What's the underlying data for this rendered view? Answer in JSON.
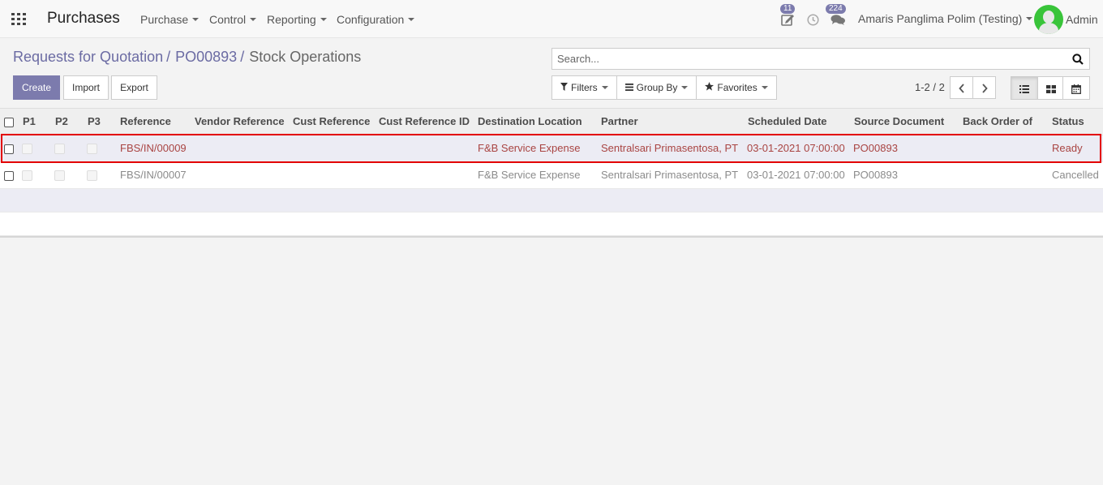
{
  "navbar": {
    "app_title": "Purchases",
    "menus": [
      "Purchase",
      "Control",
      "Reporting",
      "Configuration"
    ],
    "activity_badge": "11",
    "messages_badge": "224",
    "company": "Amaris Panglima Polim (Testing)",
    "user": "Admin"
  },
  "breadcrumb": {
    "items": [
      "Requests for Quotation",
      "PO00893"
    ],
    "separator": "/",
    "current": "Stock Operations"
  },
  "search": {
    "placeholder": "Search..."
  },
  "buttons": {
    "create": "Create",
    "import": "Import",
    "export": "Export"
  },
  "filters": {
    "filters": "Filters",
    "group_by": "Group By",
    "favorites": "Favorites"
  },
  "pager": {
    "value": "1-2 / 2"
  },
  "table": {
    "columns": [
      "P1",
      "P2",
      "P3",
      "Reference",
      "Vendor Reference",
      "Cust Reference",
      "Cust Reference ID",
      "Destination Location",
      "Partner",
      "Scheduled Date",
      "Source Document",
      "Back Order of",
      "Status"
    ],
    "rows": [
      {
        "reference": "FBS/IN/00009",
        "vendor_reference": "",
        "cust_reference": "",
        "cust_reference_id": "",
        "destination": "F&B Service Expense",
        "partner": "Sentralsari Primasentosa, PT",
        "scheduled_date": "03-01-2021 07:00:00",
        "source_document": "PO00893",
        "back_order_of": "",
        "status": "Ready"
      },
      {
        "reference": "FBS/IN/00007",
        "vendor_reference": "",
        "cust_reference": "",
        "cust_reference_id": "",
        "destination": "F&B Service Expense",
        "partner": "Sentralsari Primasentosa, PT",
        "scheduled_date": "03-01-2021 07:00:00",
        "source_document": "PO00893",
        "back_order_of": "",
        "status": "Cancelled"
      }
    ]
  },
  "colors": {
    "accent": "#7c7bad",
    "ready_row_text": "#a94442",
    "highlight_border": "#e30000"
  }
}
